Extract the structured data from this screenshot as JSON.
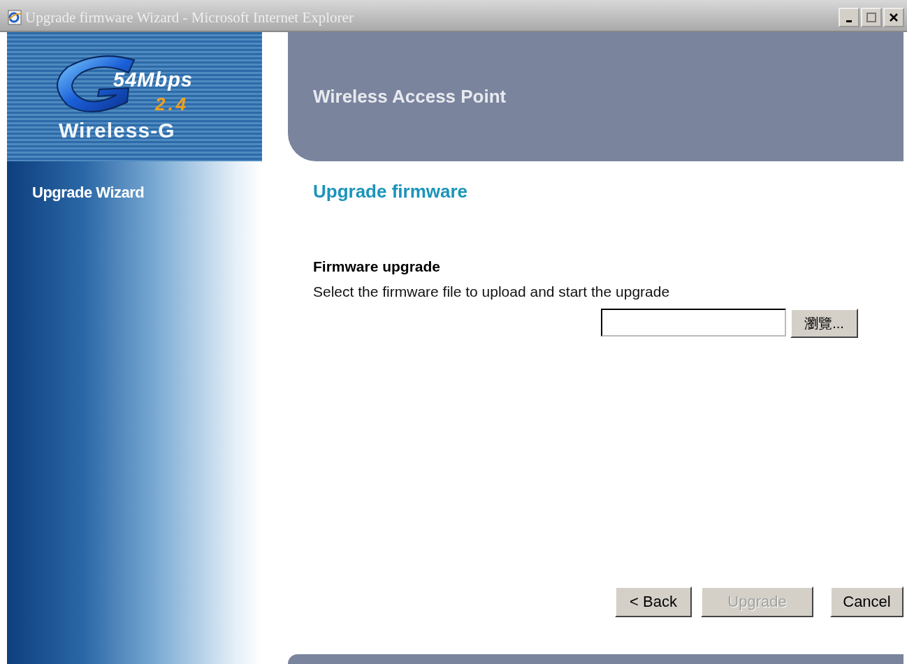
{
  "window": {
    "title": "Upgrade firmware Wizard - Microsoft Internet Explorer"
  },
  "logo": {
    "speed": "54Mbps",
    "band": "2.4",
    "brand": "Wireless-G"
  },
  "sidebar": {
    "title": "Upgrade Wizard"
  },
  "header": {
    "title": "Wireless Access Point"
  },
  "page": {
    "heading": "Upgrade firmware",
    "section": "Firmware upgrade",
    "description": "Select the firmware file to upload and start the upgrade"
  },
  "file_field": {
    "browse_label": "瀏覽..."
  },
  "buttons": [
    {
      "label": "< Back",
      "disabled": false
    },
    {
      "label": "Upgrade",
      "disabled": true
    },
    {
      "label": "Cancel",
      "disabled": false
    }
  ]
}
